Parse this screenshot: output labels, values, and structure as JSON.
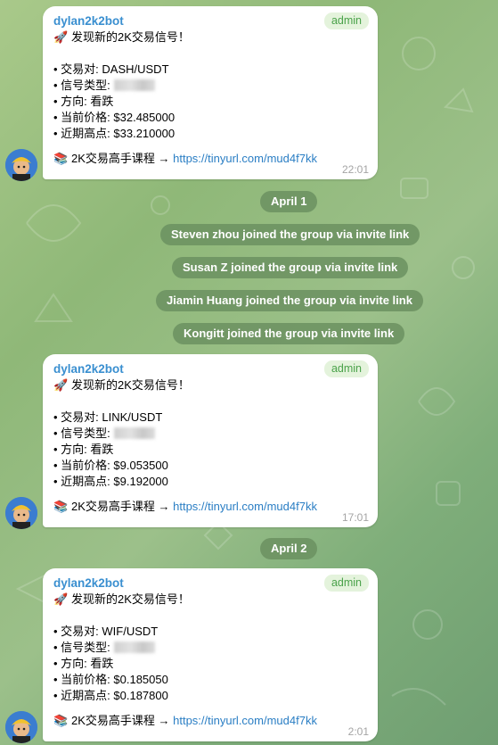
{
  "messages": [
    {
      "sender": "dylan2k2bot",
      "badge": "admin",
      "headline": "发现新的2K交易信号！",
      "pair": "• 交易对: DASH/USDT",
      "signal_type": "• 信号类型: ",
      "direction": "• 方向: 看跌",
      "price": "• 当前价格: $32.485000",
      "recent_high": "• 近期高点: $33.210000",
      "course_label": "2K交易高手课程 → ",
      "course_link": "https://tinyurl.com/mud4f7kk",
      "time": "22:01"
    },
    {
      "sender": "dylan2k2bot",
      "badge": "admin",
      "headline": "发现新的2K交易信号！",
      "pair": "• 交易对: LINK/USDT",
      "signal_type": "• 信号类型: ",
      "direction": "• 方向: 看跌",
      "price": "• 当前价格: $9.053500",
      "recent_high": "• 近期高点: $9.192000",
      "course_label": "2K交易高手课程 → ",
      "course_link": "https://tinyurl.com/mud4f7kk",
      "time": "17:01"
    },
    {
      "sender": "dylan2k2bot",
      "badge": "admin",
      "headline": "发现新的2K交易信号！",
      "pair": "• 交易对: WIF/USDT",
      "signal_type": "• 信号类型: ",
      "direction": "• 方向: 看跌",
      "price": "• 当前价格: $0.185050",
      "recent_high": "• 近期高点: $0.187800",
      "course_label": "2K交易高手课程 → ",
      "course_link": "https://tinyurl.com/mud4f7kk",
      "time": "2:01"
    }
  ],
  "dates": [
    "April 1",
    "April 2"
  ],
  "service": [
    "Steven zhou joined the group via invite link",
    "Susan Z joined the group via invite link",
    "Jiamin Huang joined the group via invite link",
    "Kongitt joined the group via invite link"
  ],
  "icons": {
    "headline": "rocket-icon",
    "course": "books-icon",
    "avatar": "bot-avatar"
  },
  "colors": {
    "sender": "#3a8fd0",
    "link": "#2a7ec4",
    "badge_text": "#4aa24a",
    "pill_bg": "#6b9160"
  }
}
